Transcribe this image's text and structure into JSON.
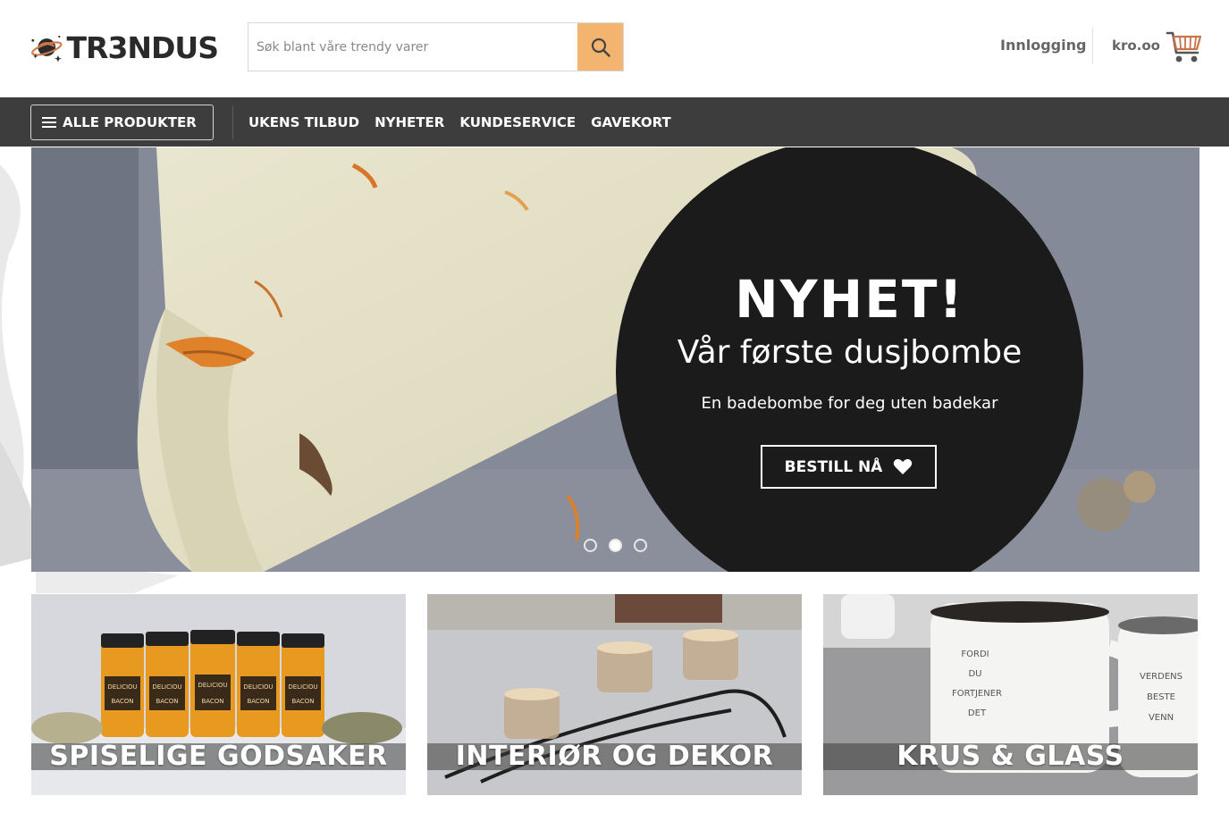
{
  "header": {
    "logo_text": "TR3NDUS",
    "search": {
      "placeholder": "Søk blant våre trendy varer",
      "value": ""
    },
    "login_label": "Innlogging",
    "cart_total": "kro.oo"
  },
  "nav": {
    "all_products_label": "ALLE PRODUKTER",
    "links": [
      "UKENS TILBUD",
      "NYHETER",
      "KUNDESERVICE",
      "GAVEKORT"
    ]
  },
  "hero": {
    "title": "NYHET!",
    "subtitle": "Vår første dusjbombe",
    "description": "En badebombe for deg uten badekar",
    "cta_label": "BESTILL NÅ",
    "slides_count": 3,
    "active_slide": 2
  },
  "categories": [
    {
      "label": "SPISELIGE GODSAKER"
    },
    {
      "label": "INTERIØR OG DEKOR"
    },
    {
      "label": "KRUS & GLASS"
    }
  ],
  "product_texts": {
    "jar_brand": "DELICIOU",
    "jar_flavor": "BACON",
    "mug1": [
      "FORDI",
      "DU",
      "FORTJENER",
      "DET"
    ],
    "mug2": [
      "VERDENS",
      "BESTE",
      "VENN"
    ]
  },
  "colors": {
    "nav_bg": "#3d3d3d",
    "search_button": "#f2b46f",
    "hero_circle": "#1b1b1b",
    "text_muted": "#666666"
  },
  "icons": {
    "search": "search-icon",
    "cart": "cart-icon",
    "menu": "hamburger-icon",
    "heart": "heart-icon",
    "logo": "planet-icon"
  }
}
